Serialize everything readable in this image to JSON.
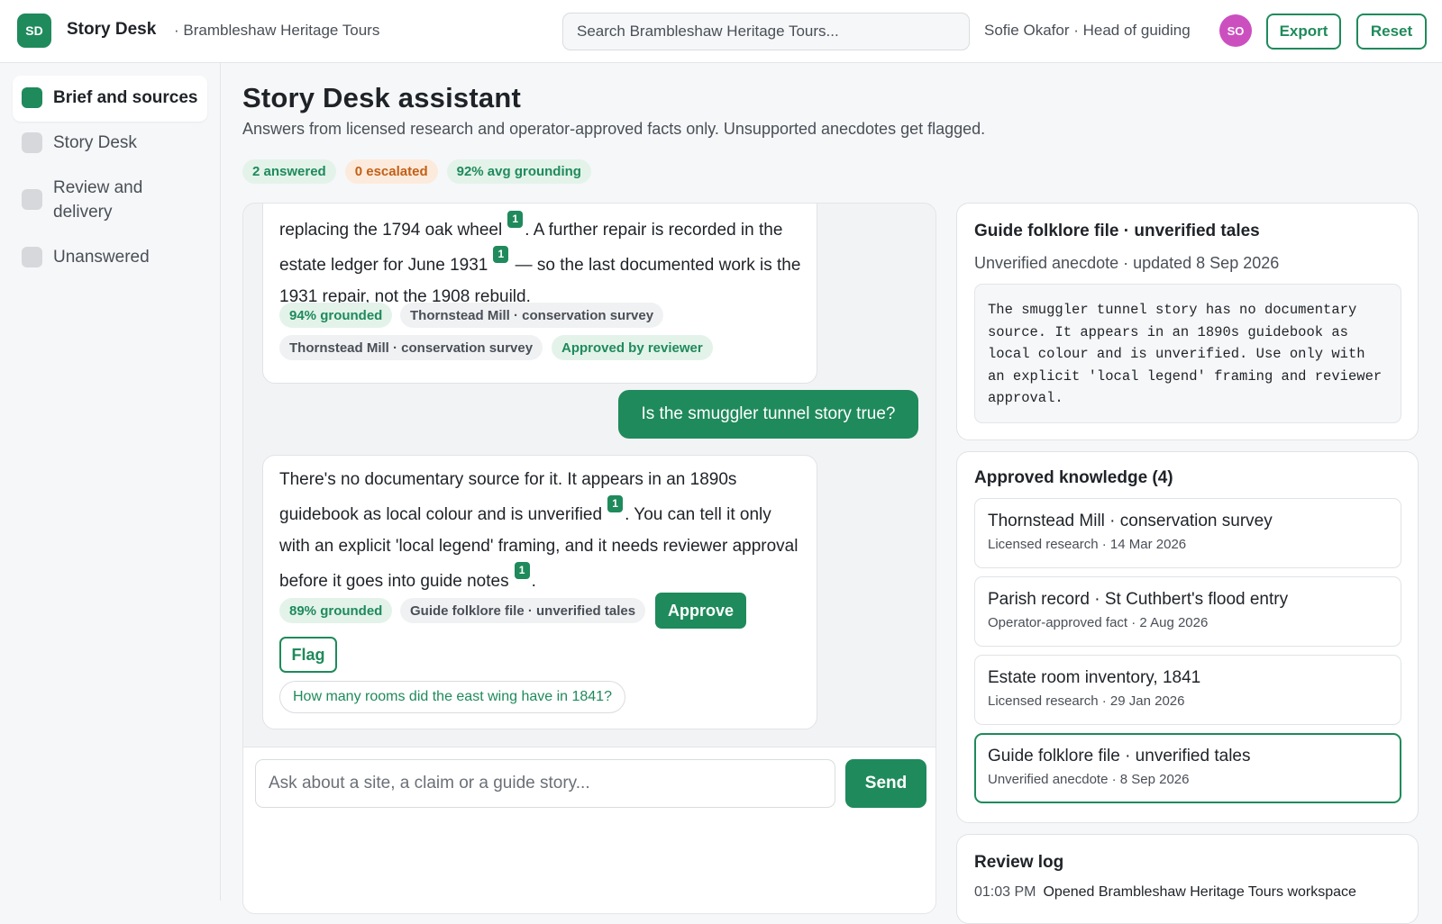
{
  "header": {
    "logo_initials": "SD",
    "app_name": "Story Desk",
    "workspace": "· Brambleshaw Heritage Tours",
    "search_placeholder": "Search Brambleshaw Heritage Tours...",
    "user": "Sofie Okafor · Head of guiding",
    "avatar_initials": "SO",
    "export_label": "Export",
    "reset_label": "Reset"
  },
  "sidebar": {
    "items": [
      {
        "label": "Brief and sources",
        "active": true
      },
      {
        "label": "Story Desk",
        "active": false
      },
      {
        "label": "Review and delivery",
        "active": false
      },
      {
        "label": "Unanswered",
        "active": false
      }
    ]
  },
  "main": {
    "title": "Story Desk assistant",
    "subtitle": "Answers from licensed research and operator-approved facts only. Unsupported anecdotes get flagged.",
    "stats": {
      "answered": "2 answered",
      "escalated": "0 escalated",
      "grounding": "92% avg grounding"
    }
  },
  "chat": {
    "messages": [
      {
        "role": "assistant",
        "text_parts": [
          "replacing the 1794 oak wheel",
          ". A further repair is recorded in the estate ledger for June 1931",
          " — so the last documented work is the 1931 repair, not the 1908 rebuild."
        ],
        "citations": [
          "1",
          "1"
        ],
        "grounded": "94% grounded",
        "sources": [
          "Thornstead Mill · conservation survey",
          "Thornstead Mill · conservation survey"
        ],
        "status": "Approved by reviewer"
      },
      {
        "role": "user",
        "text": "Is the smuggler tunnel story true?"
      },
      {
        "role": "assistant",
        "text_parts": [
          "There's no documentary source for it. It appears in an 1890s guidebook as local colour and is unverified",
          ". You can tell it only with an explicit 'local legend' framing, and it needs reviewer approval before it goes into guide notes",
          "."
        ],
        "citations": [
          "1",
          "1"
        ],
        "grounded": "89% grounded",
        "source": "Guide folklore file · unverified tales",
        "approve_label": "Approve",
        "flag_label": "Flag",
        "suggestion": "How many rooms did the east wing have in 1841?"
      }
    ],
    "input_placeholder": "Ask about a site, a claim or a guide story...",
    "send_label": "Send"
  },
  "folklore_card": {
    "title": "Guide folklore file · unverified tales",
    "meta": "Unverified anecdote · updated 8 Sep 2026",
    "content": "The smuggler tunnel story has no documentary source. It appears in an 1890s guidebook as local colour and is unverified. Use only with an explicit 'local legend' framing and reviewer approval."
  },
  "knowledge": {
    "title": "Approved knowledge (4)",
    "items": [
      {
        "name": "Thornstead Mill · conservation survey",
        "meta": "Licensed research · 14 Mar 2026",
        "selected": false
      },
      {
        "name": "Parish record · St Cuthbert's flood entry",
        "meta": "Operator-approved fact · 2 Aug 2026",
        "selected": false
      },
      {
        "name": "Estate room inventory, 1841",
        "meta": "Licensed research · 29 Jan 2026",
        "selected": false
      },
      {
        "name": "Guide folklore file · unverified tales",
        "meta": "Unverified anecdote · 8 Sep 2026",
        "selected": true
      }
    ]
  },
  "review_log": {
    "title": "Review log",
    "entries": [
      {
        "time": "01:03 PM",
        "text": "Opened Brambleshaw Heritage Tours workspace"
      }
    ]
  },
  "colors": {
    "accent": "#1f8a5b",
    "avatar": "#cc4fc0",
    "escalated": "#c35f16"
  }
}
